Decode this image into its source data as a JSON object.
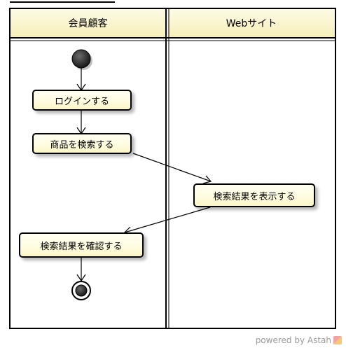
{
  "lanes": [
    {
      "title": "会員顧客"
    },
    {
      "title": "Webサイト"
    }
  ],
  "nodes": {
    "login": "ログインする",
    "search_products": "商品を検索する",
    "show_results": "検索結果を表示する",
    "confirm_results": "検索結果を確認する"
  },
  "watermark": {
    "text": "powered by Astah"
  },
  "colors": {
    "lane_header_top": "#fdfbe6",
    "lane_header_bottom": "#f6efb8",
    "node_fill": "#fffce0",
    "stroke": "#000000"
  }
}
